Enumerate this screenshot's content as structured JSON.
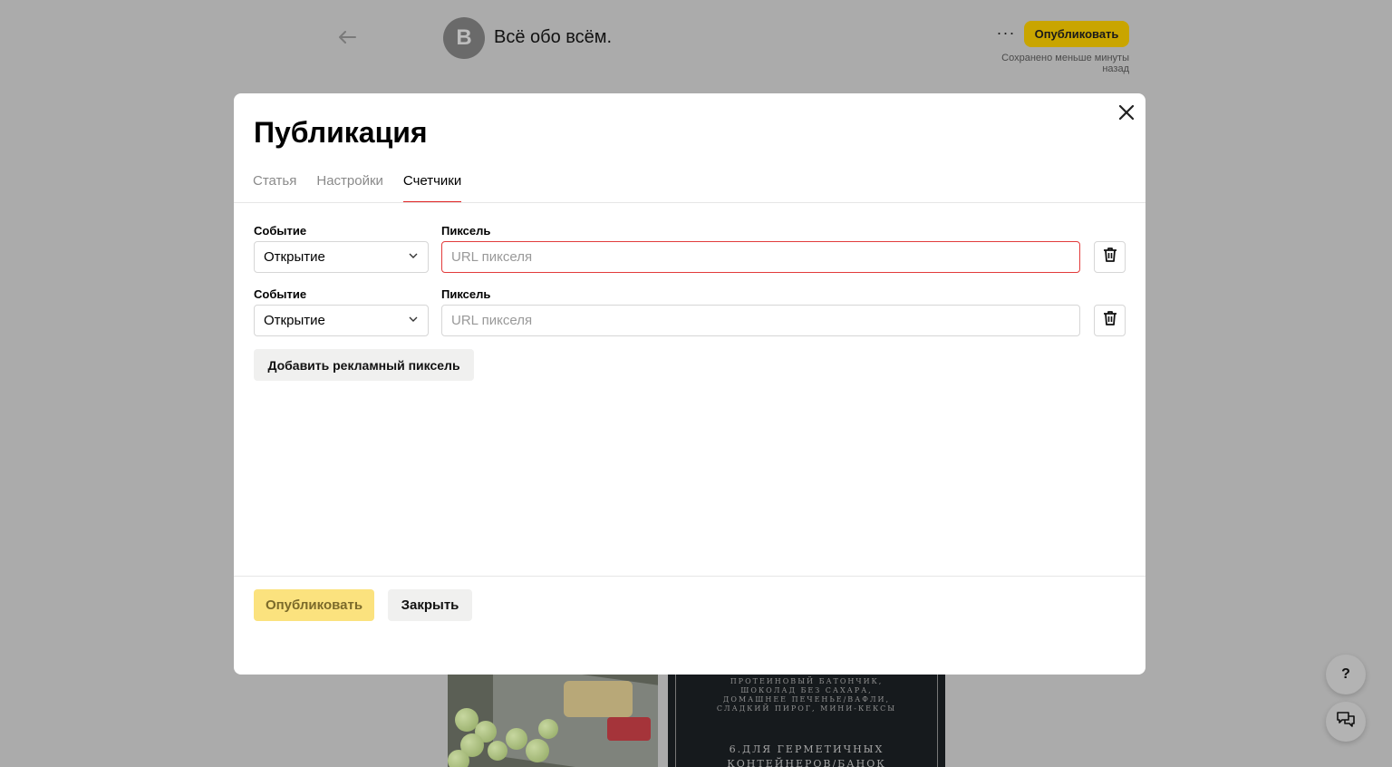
{
  "header": {
    "channel_initial": "В",
    "channel_name": "Всё обо всём.",
    "more_label": "···",
    "publish_label": "Опубликовать",
    "saved_status": "Сохранено меньше минуты назад"
  },
  "modal": {
    "title": "Публикация",
    "tabs": [
      {
        "label": "Статья",
        "active": false
      },
      {
        "label": "Настройки",
        "active": false
      },
      {
        "label": "Счетчики",
        "active": true
      }
    ],
    "rows": [
      {
        "event_label": "Событие",
        "event_value": "Открытие",
        "pixel_label": "Пиксель",
        "pixel_placeholder": "URL пикселя",
        "pixel_value": "",
        "error": true
      },
      {
        "event_label": "Событие",
        "event_value": "Открытие",
        "pixel_label": "Пиксель",
        "pixel_placeholder": "URL пикселя",
        "pixel_value": "",
        "error": false
      }
    ],
    "add_pixel_label": "Добавить рекламный пиксель",
    "footer": {
      "publish_label": "Опубликовать",
      "close_label": "Закрыть"
    }
  },
  "article_image": {
    "lines": [
      "ПРОТЕИНОВЫЙ БАТОНЧИК,",
      "ШОКОЛАД БЕЗ САХАРА,",
      "ДОМАШНЕЕ ПЕЧЕНЬЕ/ВАФЛИ,",
      "СЛАДКИЙ ПИРОГ, МИНИ-КЕКСЫ"
    ],
    "heading_line1": "6.ДЛЯ ГЕРМЕТИЧНЫХ",
    "heading_line2": "КОНТЕЙНЕРОВ/БАНОК"
  },
  "floating": {
    "help_label": "?",
    "chat_icon": "chat-bubbles-icon"
  },
  "colors": {
    "accent_yellow": "#ffdb4d",
    "error_red": "#e23b3b",
    "tab_underline": "#e02323"
  }
}
